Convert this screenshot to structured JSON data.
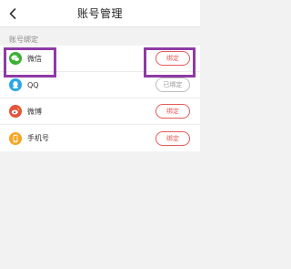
{
  "header": {
    "title": "账号管理"
  },
  "section": {
    "label": "账号绑定"
  },
  "accounts": [
    {
      "name": "微信",
      "icon": "wechat-icon",
      "color": "#3cb034",
      "action": "绑定",
      "state": "unbound"
    },
    {
      "name": "QQ",
      "icon": "qq-icon",
      "color": "#2aa6e8",
      "action": "已绑定",
      "state": "bound"
    },
    {
      "name": "微博",
      "icon": "weibo-icon",
      "color": "#e5533c",
      "action": "绑定",
      "state": "unbound"
    },
    {
      "name": "手机号",
      "icon": "phone-icon",
      "color": "#f5a623",
      "action": "绑定",
      "state": "unbound"
    }
  ],
  "colors": {
    "accent": "#e65a5a",
    "highlight": "#8e3aa6",
    "bound_gray": "#9a9a9a"
  }
}
